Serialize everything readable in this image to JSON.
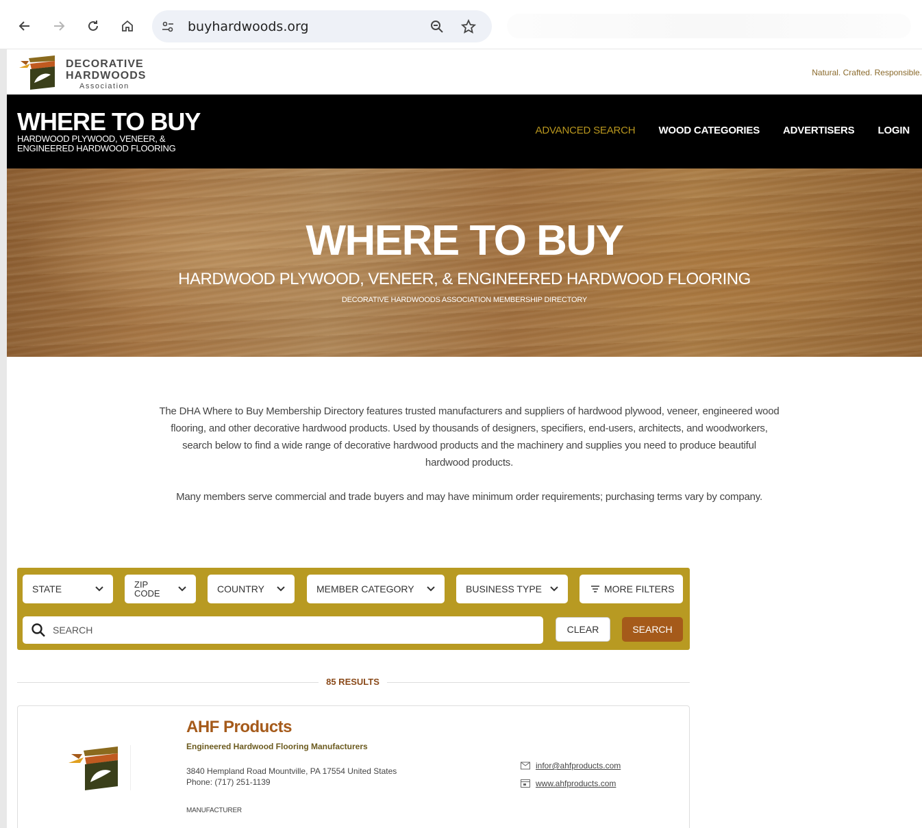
{
  "browser": {
    "url": "buyhardwoods.org"
  },
  "site": {
    "logo": {
      "line1": "DECORATIVE",
      "line2": "HARDWOODS",
      "line3": "Association"
    },
    "tagline": "Natural. Crafted. Responsible."
  },
  "nav": {
    "title": "WHERE TO BUY",
    "subtitle_line1": "HARDWOOD PLYWOOD, VENEER, &",
    "subtitle_line2": "ENGINEERED HARDWOOD FLOORING",
    "menu": [
      {
        "label": "ADVANCED SEARCH",
        "active": true
      },
      {
        "label": "WOOD CATEGORIES",
        "active": false
      },
      {
        "label": "ADVERTISERS",
        "active": false
      },
      {
        "label": "LOGIN",
        "active": false
      }
    ]
  },
  "hero": {
    "title": "WHERE TO BUY",
    "subtitle": "HARDWOOD PLYWOOD, VENEER, & ENGINEERED HARDWOOD FLOORING",
    "subtitle2": "DECORATIVE HARDWOODS ASSOCIATION MEMBERSHIP DIRECTORY"
  },
  "intro": {
    "p1": "The DHA Where to Buy Membership Directory features trusted manufacturers and suppliers of hardwood plywood, veneer, engineered wood flooring, and other decorative hardwood products. Used by thousands of designers, specifiers, end-users, architects, and woodworkers, search below to find a wide range of decorative hardwood products and the machinery and supplies you need to produce beautiful hardwood products.",
    "p2": "Many members serve commercial and trade buyers and may have minimum order requirements; purchasing terms vary by company."
  },
  "filters": {
    "state": "STATE",
    "zip_line1": "ZIP",
    "zip_line2": "CODE",
    "country": "COUNTRY",
    "member_category": "MEMBER CATEGORY",
    "business_type": "BUSINESS TYPE",
    "more_filters": "MORE FILTERS",
    "search_placeholder": "SEARCH",
    "clear": "CLEAR",
    "search": "SEARCH"
  },
  "results": {
    "count": "85 RESULTS",
    "items": [
      {
        "company": "AHF Products",
        "category": "Engineered Hardwood Flooring Manufacturers",
        "address": "3840 Hempland Road Mountville, PA 17554 United States",
        "phone": "Phone: (717) 251-1139",
        "business_type": "MANUFACTURER",
        "email": "infor@ahfproducts.com",
        "website": "www.ahfproducts.com"
      }
    ]
  },
  "colors": {
    "gold": "#b89a22",
    "brown": "#a55a1a",
    "black": "#000000"
  }
}
